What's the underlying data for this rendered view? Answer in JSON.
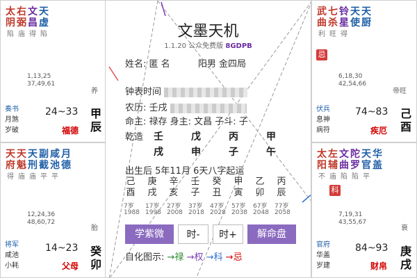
{
  "center": {
    "title": "文墨天机",
    "version": "1.1.20",
    "edition": "公众免费版",
    "code": "8GDPB",
    "name_label": "姓名:",
    "name_value": "匿 名",
    "gender_value": "阳男 金四局",
    "clock_label": "钟表时间",
    "lunar_label": "农历:",
    "lunar_value": "壬戌",
    "master_line": "命主: 禄存 身主: 文昌 子斗: 子",
    "qianzao_label": "乾造",
    "stems": [
      "壬",
      "戊",
      "丙",
      "甲"
    ],
    "branches": [
      "戌",
      "申",
      "子",
      "午"
    ],
    "luck_line": "出生后 5年11月 6天八字起运",
    "dayun_stems": [
      "己",
      "庚",
      "辛",
      "壬",
      "癸",
      "甲",
      "乙",
      "丙"
    ],
    "dayun_branches": [
      "酉",
      "戌",
      "亥",
      "子",
      "丑",
      "寅",
      "卯",
      "辰"
    ],
    "dayun_ages": [
      "7岁",
      "17岁",
      "27岁",
      "37岁",
      "47岁",
      "57岁",
      "67岁",
      "77岁"
    ],
    "dayun_years": [
      "1988",
      "1998",
      "2008",
      "2018",
      "2028",
      "2038",
      "2048",
      "2058"
    ],
    "buttons": [
      "学紫微",
      "时-",
      "时+",
      "解命盘"
    ],
    "legend_label": "自化图示:",
    "legend_items": [
      "→禄",
      "→权",
      "→科",
      "→忌"
    ]
  },
  "cells": {
    "top_left": {
      "stars": [
        "太阴",
        "右弼",
        "文昌",
        "天虚"
      ],
      "brightness": [
        "陷",
        "庙",
        "得",
        "陷"
      ],
      "ages": [
        "1,13,25",
        "37,49,61"
      ],
      "stage": "养",
      "minor": [
        "奏书",
        "月煞",
        "岁破"
      ],
      "range": "24~33",
      "palace": "福德",
      "stem": [
        "甲",
        "辰"
      ]
    },
    "top_right": {
      "stars": [
        "武曲",
        "七杀",
        "铃星",
        "天使",
        "天厨"
      ],
      "brightness": [
        "利",
        "旺",
        "得",
        "",
        ""
      ],
      "hua": "忌",
      "ages": [
        "6,18,30",
        "42,54,66"
      ],
      "stage": "帝旺",
      "minor": [
        "伏兵",
        "息神",
        "病符"
      ],
      "range": "74~83",
      "palace": "疾厄",
      "stem": [
        "己",
        "酉"
      ]
    },
    "mid_left": {
      "stars": [
        "天府",
        "天魁",
        "天刑",
        "副截",
        "咸池",
        "月德"
      ],
      "brightness": [
        "得",
        "庙",
        "庙",
        "平",
        "平",
        ""
      ],
      "ages": [
        "12,24,36",
        "48,60,72"
      ],
      "stage": "胎",
      "minor": [
        "将军",
        "咸池",
        "小耗"
      ],
      "range": "14~23",
      "palace": "父母",
      "stem": [
        "癸",
        "卯"
      ]
    },
    "mid_right": {
      "stars": [
        "太阳",
        "左辅",
        "文曲",
        "陀罗",
        "天官",
        "华盖"
      ],
      "brightness": [
        "不",
        "庙",
        "陷",
        "陷",
        "平",
        ""
      ],
      "hua": "科",
      "ages": [
        "7,19,31",
        "43,55,67"
      ],
      "stage": "衰",
      "minor": [
        "官府",
        "华盖",
        "岁建"
      ],
      "range": "84~93",
      "palace": "财帛",
      "stem": [
        "庚",
        "戌"
      ]
    }
  }
}
